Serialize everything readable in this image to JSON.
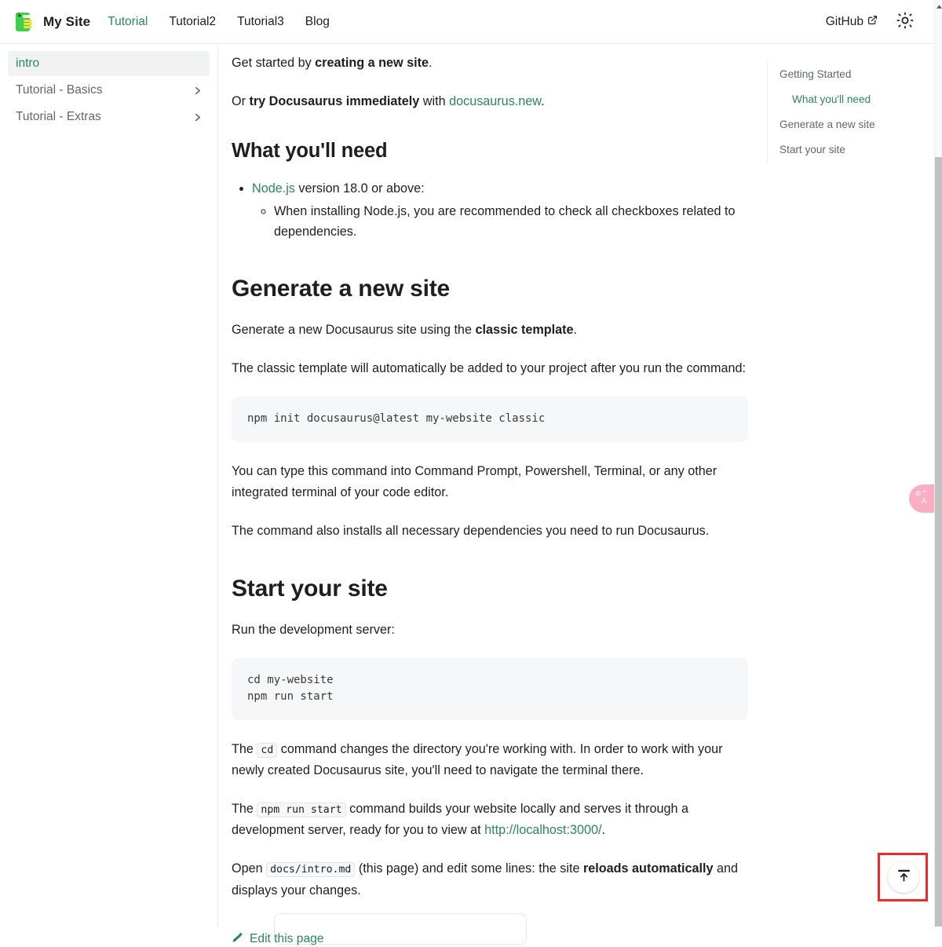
{
  "navbar": {
    "logo_icon": "docusaurus-mascot-logo",
    "brand": "My Site",
    "links": [
      {
        "label": "Tutorial",
        "active": true
      },
      {
        "label": "Tutorial2",
        "active": false
      },
      {
        "label": "Tutorial3",
        "active": false
      },
      {
        "label": "Blog",
        "active": false
      }
    ],
    "github_label": "GitHub",
    "github_icon": "external-link-icon",
    "theme_toggle_icon": "sun-icon"
  },
  "sidebar": {
    "items": [
      {
        "label": "intro",
        "active": true,
        "expandable": false
      },
      {
        "label": "Tutorial - Basics",
        "active": false,
        "expandable": true
      },
      {
        "label": "Tutorial - Extras",
        "active": false,
        "expandable": true
      }
    ]
  },
  "content": {
    "intro_p1_pre": "Get started by ",
    "intro_p1_strong": "creating a new site",
    "intro_p1_post": ".",
    "intro_p2_pre": "Or ",
    "intro_p2_strong": "try Docusaurus immediately",
    "intro_p2_mid": " with ",
    "intro_p2_link": "docusaurus.new",
    "intro_p2_post": ".",
    "h2_what_youll_need": "What you'll need",
    "need_item_link": "Node.js",
    "need_item_rest": " version 18.0 or above:",
    "need_subitem": "When installing Node.js, you are recommended to check all checkboxes related to dependencies.",
    "h2_generate": "Generate a new site",
    "gen_p1_pre": "Generate a new Docusaurus site using the ",
    "gen_p1_strong": "classic template",
    "gen_p1_post": ".",
    "gen_p2": "The classic template will automatically be added to your project after you run the command:",
    "code_block_1": "npm init docusaurus@latest my-website classic",
    "gen_p3": "You can type this command into Command Prompt, Powershell, Terminal, or any other integrated terminal of your code editor.",
    "gen_p4": "The command also installs all necessary dependencies you need to run Docusaurus.",
    "h2_start": "Start your site",
    "start_p1": "Run the development server:",
    "code_block_2": "cd my-website\nnpm run start",
    "start_p2_pre": "The ",
    "start_p2_code": "cd",
    "start_p2_post": " command changes the directory you're working with. In order to work with your newly created Docusaurus site, you'll need to navigate the terminal there.",
    "start_p3_pre": "The ",
    "start_p3_code": "npm run start",
    "start_p3_mid": " command builds your website locally and serves it through a development server, ready for you to view at ",
    "start_p3_link": "http://localhost:3000/",
    "start_p3_post": ".",
    "start_p4_pre": "Open ",
    "start_p4_code": "docs/intro.md",
    "start_p4_mid": " (this page) and edit some lines: the site ",
    "start_p4_strong": "reloads automatically",
    "start_p4_post": " and displays your changes.",
    "edit_page_label": "Edit this page",
    "edit_page_icon": "pencil-icon"
  },
  "toc": {
    "items": [
      {
        "label": "Getting Started",
        "sub": false,
        "active": false
      },
      {
        "label": "What you'll need",
        "sub": true,
        "active": true
      },
      {
        "label": "Generate a new site",
        "sub": false,
        "active": false
      },
      {
        "label": "Start your site",
        "sub": false,
        "active": false
      }
    ]
  },
  "widgets": {
    "translate_icon": "translate-icon",
    "translate_glyph": "中A",
    "back_to_top_icon": "scroll-to-top-icon"
  },
  "colors": {
    "accent_green": "#2e8555",
    "text": "#1c1e21",
    "muted_text": "#606770",
    "code_bg": "#f6f7f8",
    "border": "#ececec",
    "highlight_red": "#ef2a2a",
    "translate_pink": "#f9aec4"
  }
}
